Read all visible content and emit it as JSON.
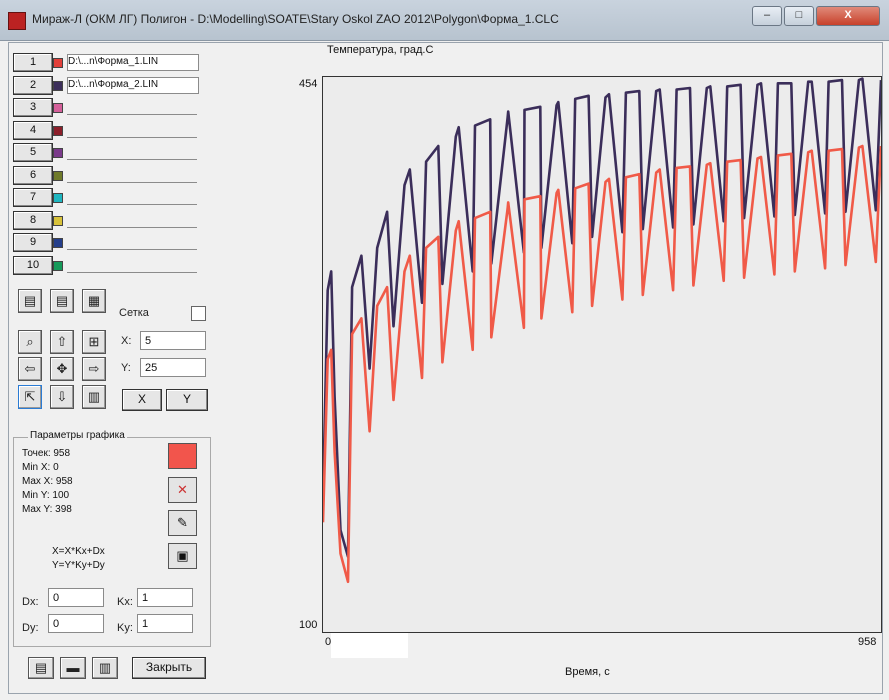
{
  "window": {
    "title": "Мираж-Л (ОКМ ЛГ) Полигон - D:\\Modelling\\SOATE\\Stary Oskol ZAO 2012\\Polygon\\Форма_1.CLC",
    "minimize": "–",
    "maximize": "□",
    "close": "X"
  },
  "series_list": [
    {
      "num": "1",
      "color": "#e2403a",
      "file": "D:\\...n\\Форма_1.LIN"
    },
    {
      "num": "2",
      "color": "#3b2e5a",
      "file": "D:\\...n\\Форма_2.LIN"
    },
    {
      "num": "3",
      "color": "#d4609a",
      "file": ""
    },
    {
      "num": "4",
      "color": "#8c1f2a",
      "file": ""
    },
    {
      "num": "5",
      "color": "#7a3a8a",
      "file": ""
    },
    {
      "num": "6",
      "color": "#6f7a2a",
      "file": ""
    },
    {
      "num": "7",
      "color": "#1fb6c0",
      "file": ""
    },
    {
      "num": "8",
      "color": "#d8c23a",
      "file": ""
    },
    {
      "num": "9",
      "color": "#243e8a",
      "file": ""
    },
    {
      "num": "10",
      "color": "#169a5a",
      "file": ""
    }
  ],
  "grid": {
    "label": "Сетка",
    "x_label": "X:",
    "x_value": "5",
    "y_label": "Y:",
    "y_value": "25",
    "x_button": "X",
    "y_button": "Y"
  },
  "params": {
    "title": "Параметры графика",
    "points": "Точек: 958",
    "min_x": "Min X: 0",
    "max_x": "Max X: 958",
    "min_y": "Min Y: 100",
    "max_y": "Max Y: 398",
    "formula_x": "X=X*Kx+Dx",
    "formula_y": "Y=Y*Ky+Dy",
    "dx_label": "Dx:",
    "dx_value": "0",
    "kx_label": "Kx:",
    "kx_value": "1",
    "dy_label": "Dy:",
    "dy_value": "0",
    "ky_label": "Ky:",
    "ky_value": "1",
    "close_button": "Закрыть"
  },
  "chart_data": {
    "type": "line",
    "ylabel": "Температура, град.С",
    "xlabel": "Время, с",
    "xlim": [
      0,
      958
    ],
    "ylim": [
      100,
      454
    ],
    "x_tick_labels": [
      "0",
      "958"
    ],
    "y_tick_labels": [
      "100",
      "454"
    ],
    "grid": false,
    "series": [
      {
        "color": "#3b2e5a",
        "x": [
          0,
          8,
          14,
          20,
          30,
          43,
          50,
          66,
          80,
          93,
          110,
          121,
          140,
          149,
          170,
          177,
          198,
          205,
          228,
          233,
          257,
          261,
          287,
          289,
          317,
          318,
          345,
          346,
          373,
          375,
          401,
          404,
          428,
          433,
          456,
          462,
          485,
          491,
          514,
          520,
          543,
          549,
          572,
          578,
          601,
          607,
          630,
          636,
          659,
          665,
          688,
          694,
          717,
          723,
          746,
          752,
          775,
          781,
          804,
          810,
          833,
          839,
          862,
          868,
          891,
          897,
          920,
          926,
          949,
          958
        ],
        "y": [
          185,
          318,
          330,
          250,
          165,
          148,
          320,
          340,
          268,
          345,
          368,
          295,
          385,
          395,
          310,
          400,
          410,
          322,
          416,
          422,
          330,
          423,
          427,
          335,
          428,
          432,
          342,
          433,
          435,
          345,
          436,
          438,
          348,
          440,
          442,
          352,
          441,
          443,
          355,
          444,
          445,
          357,
          445,
          446,
          358,
          446,
          447,
          360,
          447,
          448,
          362,
          448,
          449,
          364,
          449,
          450,
          365,
          450,
          450,
          366,
          451,
          451,
          367,
          451,
          452,
          368,
          452,
          453,
          369,
          452
        ]
      },
      {
        "color": "#f05a48",
        "x": [
          0,
          8,
          14,
          20,
          30,
          43,
          50,
          66,
          80,
          93,
          110,
          121,
          140,
          149,
          170,
          177,
          198,
          205,
          228,
          233,
          257,
          261,
          287,
          289,
          317,
          318,
          345,
          346,
          373,
          375,
          401,
          404,
          428,
          433,
          456,
          462,
          485,
          491,
          514,
          520,
          543,
          549,
          572,
          578,
          601,
          607,
          630,
          636,
          659,
          665,
          688,
          694,
          717,
          723,
          746,
          752,
          775,
          781,
          804,
          810,
          833,
          839,
          862,
          868,
          891,
          897,
          920,
          926,
          949,
          958
        ],
        "y": [
          170,
          274,
          280,
          215,
          150,
          132,
          290,
          300,
          228,
          308,
          320,
          248,
          330,
          340,
          262,
          345,
          352,
          272,
          356,
          362,
          280,
          364,
          368,
          288,
          370,
          374,
          294,
          376,
          378,
          300,
          380,
          382,
          304,
          383,
          386,
          308,
          387,
          389,
          312,
          390,
          392,
          315,
          393,
          395,
          318,
          396,
          397,
          321,
          398,
          399,
          324,
          400,
          401,
          326,
          402,
          403,
          328,
          404,
          405,
          330,
          406,
          407,
          332,
          407,
          408,
          334,
          409,
          410,
          336,
          410
        ]
      }
    ]
  }
}
